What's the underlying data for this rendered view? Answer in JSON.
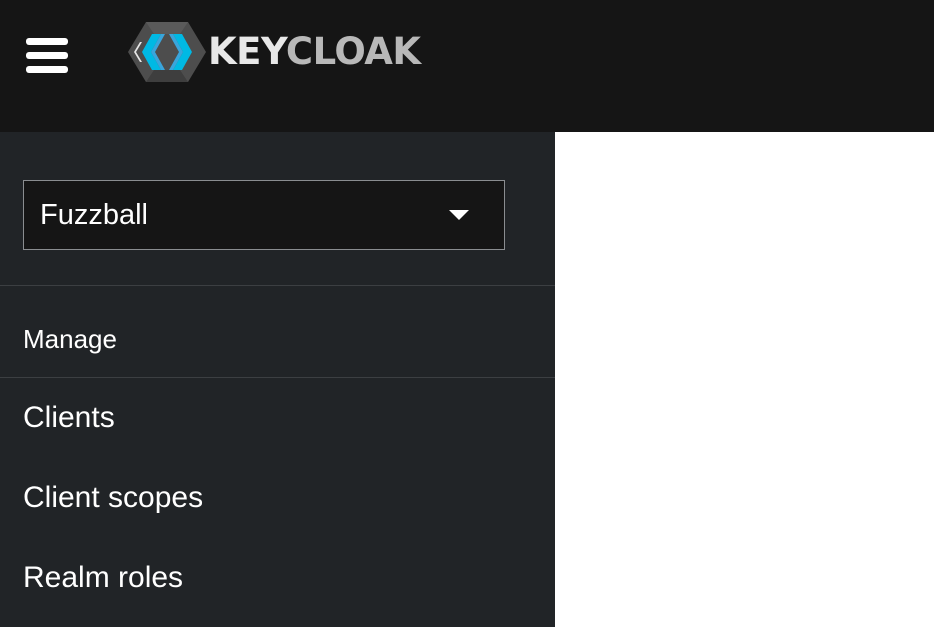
{
  "header": {
    "menu_icon": "hamburger-menu-icon",
    "logo": {
      "icon": "keycloak-logo-icon",
      "text_part1": "KEY",
      "text_part2": "CLOAK",
      "colors": {
        "hex_dark": "#4d4d4d",
        "hex_light": "#39a5dc",
        "hex_mid": "#00b9e4"
      }
    }
  },
  "sidebar": {
    "realm_selector": {
      "value": "Fuzzball",
      "icon": "caret-down-icon"
    },
    "section_title": "Manage",
    "items": [
      {
        "label": "Clients"
      },
      {
        "label": "Client scopes"
      },
      {
        "label": "Realm roles"
      }
    ]
  },
  "colors": {
    "topbar_bg": "#151515",
    "sidebar_bg": "#212427",
    "content_bg": "#ffffff",
    "text": "#ffffff"
  }
}
